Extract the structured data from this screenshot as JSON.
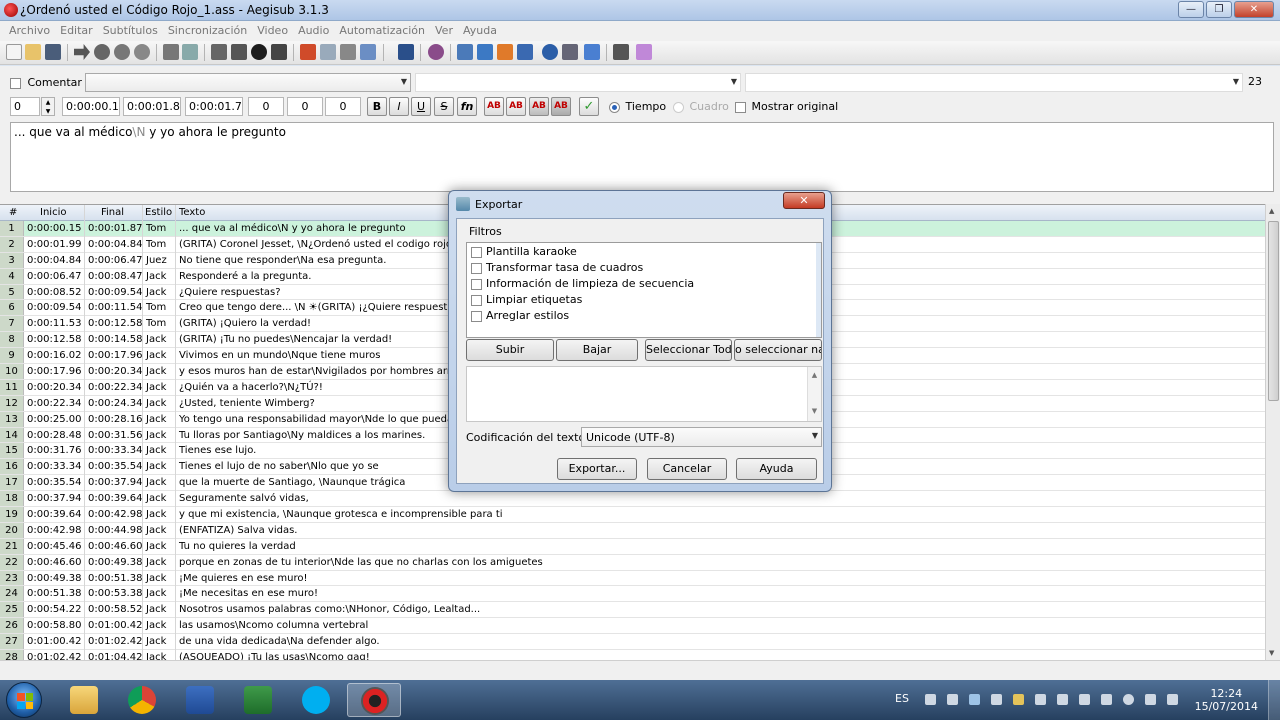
{
  "window": {
    "title": "¿Ordenó usted el Código Rojo_1.ass - Aegisub 3.1.3",
    "minimize_glyph": "—",
    "maximize_glyph": "❐",
    "close_glyph": "✕"
  },
  "menu": [
    "Archivo",
    "Editar",
    "Subtítulos",
    "Sincronización",
    "Video",
    "Audio",
    "Automatización",
    "Ver",
    "Ayuda"
  ],
  "edit": {
    "comment_label": "Comentar",
    "layer": "0",
    "start": "0:00:00.15",
    "end": "0:00:01.87",
    "duration": "0:00:01.72",
    "margin_l": "0",
    "margin_r": "0",
    "margin_v": "0",
    "char_count": "23",
    "bold": "B",
    "italic": "I",
    "underline": "U",
    "strike": "S",
    "font_btn": "fn",
    "color_btns": [
      "AB",
      "AB",
      "AB",
      "AB"
    ],
    "commit_glyph": "✓",
    "time_label": "Tiempo",
    "frame_label": "Cuadro",
    "show_original_label": "Mostrar original",
    "text_main": "... que va al médico",
    "text_tag": "\\N",
    "text_rest": " y yo ahora le pregunto"
  },
  "grid": {
    "headers": [
      "#",
      "Inicio",
      "Final",
      "Estilo",
      "Texto"
    ],
    "rows": [
      [
        "1",
        "0:00:00.15",
        "0:00:01.87",
        "Tom",
        "... que va al médico\\N y yo ahora le pregunto"
      ],
      [
        "2",
        "0:00:01.99",
        "0:00:04.84",
        "Tom",
        "(GRITA) Coronel Jesset, \\N¿Ordenó usted el codigo rojo?!"
      ],
      [
        "3",
        "0:00:04.84",
        "0:00:06.47",
        "Juez",
        "No tiene que responder\\Na esa pregunta."
      ],
      [
        "4",
        "0:00:06.47",
        "0:00:08.47",
        "Jack",
        "Responderé a la pregunta."
      ],
      [
        "5",
        "0:00:08.52",
        "0:00:09.54",
        "Jack",
        "¿Quiere respuestas?"
      ],
      [
        "6",
        "0:00:09.54",
        "0:00:11.54",
        "Tom",
        "Creo que tengo dere... \\N ☀(GRITA) ¡¿Quiere respuestas?!"
      ],
      [
        "7",
        "0:00:11.53",
        "0:00:12.58",
        "Tom",
        "(GRITA) ¡Quiero la verdad!"
      ],
      [
        "8",
        "0:00:12.58",
        "0:00:14.58",
        "Jack",
        "(GRITA) ¡Tu no puedes\\Nencajar la verdad!"
      ],
      [
        "9",
        "0:00:16.02",
        "0:00:17.96",
        "Jack",
        "Vivimos en un mundo\\Nque tiene muros"
      ],
      [
        "10",
        "0:00:17.96",
        "0:00:20.34",
        "Jack",
        "y esos muros han de estar\\Nvigilados por hombres armados"
      ],
      [
        "11",
        "0:00:20.34",
        "0:00:22.34",
        "Jack",
        "¿Quién va a hacerlo?\\N¿TÚ?!"
      ],
      [
        "12",
        "0:00:22.34",
        "0:00:24.34",
        "Jack",
        "¿Usted, teniente Wimberg?"
      ],
      [
        "13",
        "0:00:25.00",
        "0:00:28.16",
        "Jack",
        "Yo tengo una responsabilidad mayor\\Nde lo que puedas calcular"
      ],
      [
        "14",
        "0:00:28.48",
        "0:00:31.56",
        "Jack",
        "Tu lloras por Santiago\\Ny maldices a los marines."
      ],
      [
        "15",
        "0:00:31.76",
        "0:00:33.34",
        "Jack",
        "Tienes ese lujo."
      ],
      [
        "16",
        "0:00:33.34",
        "0:00:35.54",
        "Jack",
        "Tienes el lujo de no saber\\Nlo que yo se"
      ],
      [
        "17",
        "0:00:35.54",
        "0:00:37.94",
        "Jack",
        "que la muerte de Santiago, \\Naunque trágica"
      ],
      [
        "18",
        "0:00:37.94",
        "0:00:39.64",
        "Jack",
        "Seguramente salvó vidas,"
      ],
      [
        "19",
        "0:00:39.64",
        "0:00:42.98",
        "Jack",
        "y que mi existencia, \\Naunque grotesca e incomprensible para ti"
      ],
      [
        "20",
        "0:00:42.98",
        "0:00:44.98",
        "Jack",
        "(ENFATIZA) Salva vidas."
      ],
      [
        "21",
        "0:00:45.46",
        "0:00:46.60",
        "Jack",
        "Tu no quieres la verdad"
      ],
      [
        "22",
        "0:00:46.60",
        "0:00:49.38",
        "Jack",
        "porque en zonas de tu interior\\Nde las que no charlas con los amiguetes"
      ],
      [
        "23",
        "0:00:49.38",
        "0:00:51.38",
        "Jack",
        "¡Me quieres en ese muro!"
      ],
      [
        "24",
        "0:00:51.38",
        "0:00:53.38",
        "Jack",
        "¡Me necesitas en ese muro!"
      ],
      [
        "25",
        "0:00:54.22",
        "0:00:58.52",
        "Jack",
        "Nosotros usamos palabras como:\\NHonor, Código, Lealtad..."
      ],
      [
        "26",
        "0:00:58.80",
        "0:01:00.42",
        "Jack",
        "las usamos\\Ncomo columna vertebral"
      ],
      [
        "27",
        "0:01:00.42",
        "0:01:02.42",
        "Jack",
        " de una vida dedicada\\Na defender algo."
      ],
      [
        "28",
        "0:01:02.42",
        "0:01:04.42",
        "Jack",
        "(ASQUEADO) ¡Tu las usas\\Ncomo gag!"
      ]
    ]
  },
  "dialog": {
    "title": "Exportar",
    "close_glyph": "✕",
    "filters_label": "Filtros",
    "filters": [
      "Plantilla karaoke",
      "Transformar tasa de cuadros",
      "Información de limpieza de secuencia",
      "Limpiar etiquetas",
      "Arreglar estilos"
    ],
    "up_btn": "Subir",
    "down_btn": "Bajar",
    "select_all_btn": "Seleccionar Todo",
    "select_none_btn": "o seleccionar nac",
    "encoding_label": "Codificación del texto:",
    "encoding_value": "Unicode (UTF-8)",
    "export_btn": "Exportar...",
    "cancel_btn": "Cancelar",
    "help_btn": "Ayuda",
    "scroll_up": "▲",
    "scroll_down": "▼"
  },
  "taskbar": {
    "lang": "ES",
    "time": "12:24",
    "date": "15/07/2014"
  },
  "colors": {
    "selected_row": "#ccf2dc",
    "row_number_bg": "#cdd9c9",
    "tag_gray": "#8a8a8a",
    "accent_blue": "#2a62b8"
  }
}
